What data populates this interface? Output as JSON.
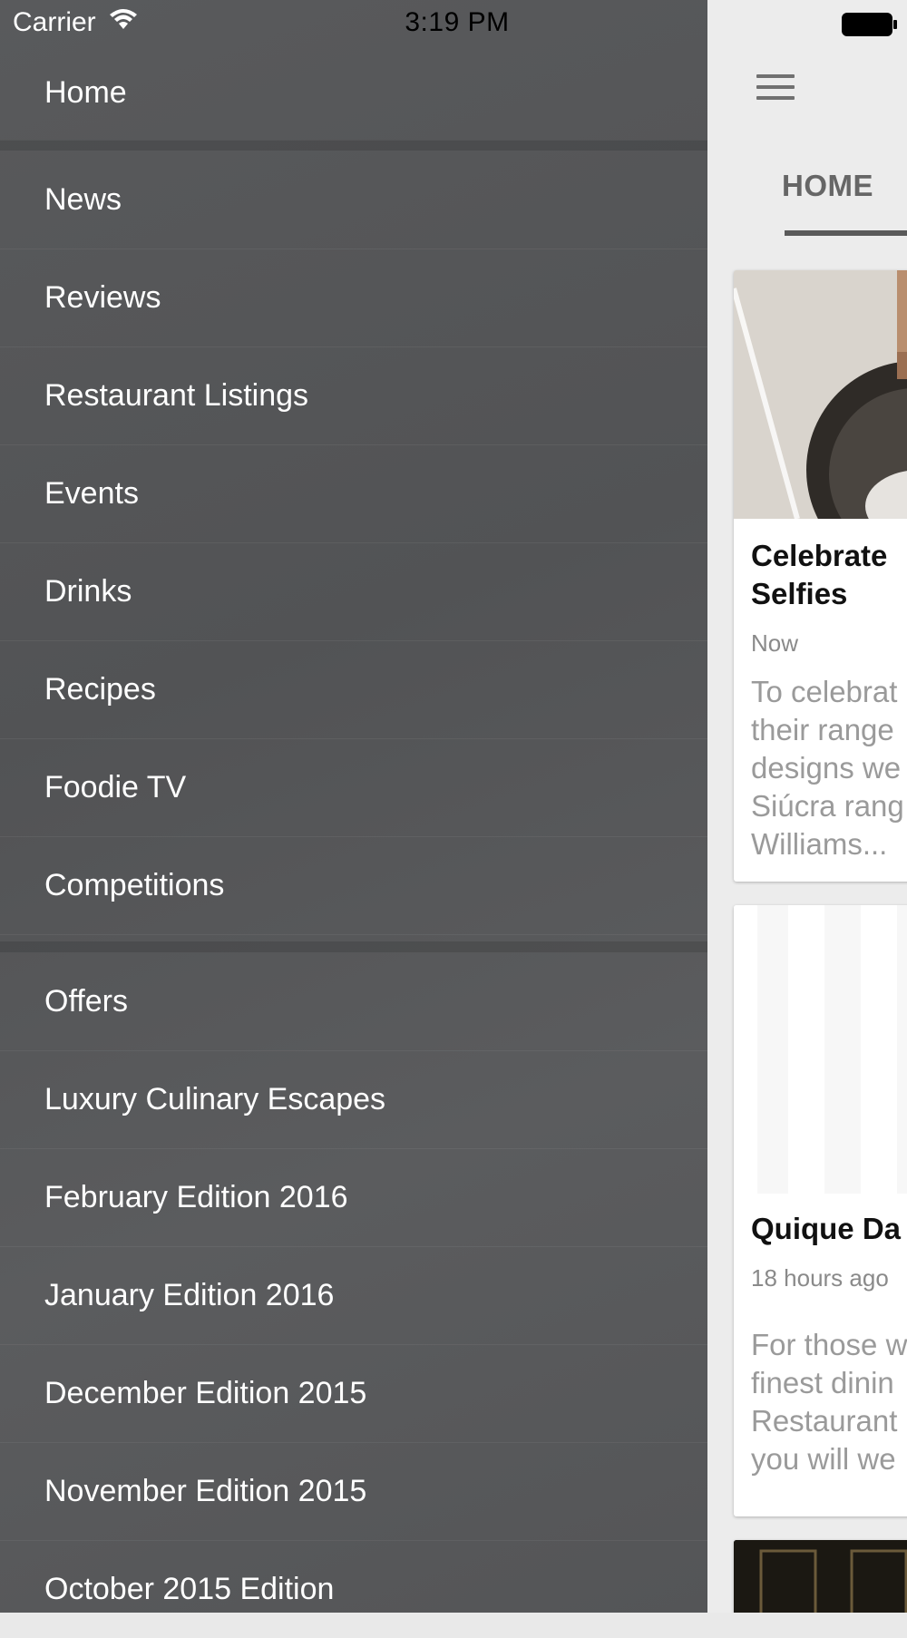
{
  "status_bar": {
    "carrier": "Carrier",
    "time": "3:19 PM"
  },
  "drawer": {
    "items": [
      {
        "label": "Home"
      },
      {
        "label": "News"
      },
      {
        "label": "Reviews"
      },
      {
        "label": "Restaurant Listings"
      },
      {
        "label": "Events"
      },
      {
        "label": "Drinks"
      },
      {
        "label": "Recipes"
      },
      {
        "label": "Foodie TV"
      },
      {
        "label": "Competitions"
      },
      {
        "label": "Offers"
      },
      {
        "label": "Luxury Culinary Escapes"
      },
      {
        "label": "February Edition 2016"
      },
      {
        "label": "January Edition 2016"
      },
      {
        "label": "December Edition 2015"
      },
      {
        "label": "November Edition 2015"
      },
      {
        "label": "October 2015 Edition"
      }
    ]
  },
  "main": {
    "tabs": [
      {
        "label": "HOME"
      }
    ],
    "cards": [
      {
        "title": "Celebrate\nSelfies",
        "time": "Now",
        "excerpt": "To celebrat\ntheir range\ndesigns we\nSiúcra rang\nWilliams..."
      },
      {
        "title": "Quique Da",
        "time": "18 hours ago",
        "excerpt": "For those w\nfinest dinin\nRestaurant\nyou will we"
      }
    ]
  },
  "icons": {
    "menu": "hamburger-icon",
    "wifi": "wifi-icon",
    "battery": "battery-icon"
  }
}
